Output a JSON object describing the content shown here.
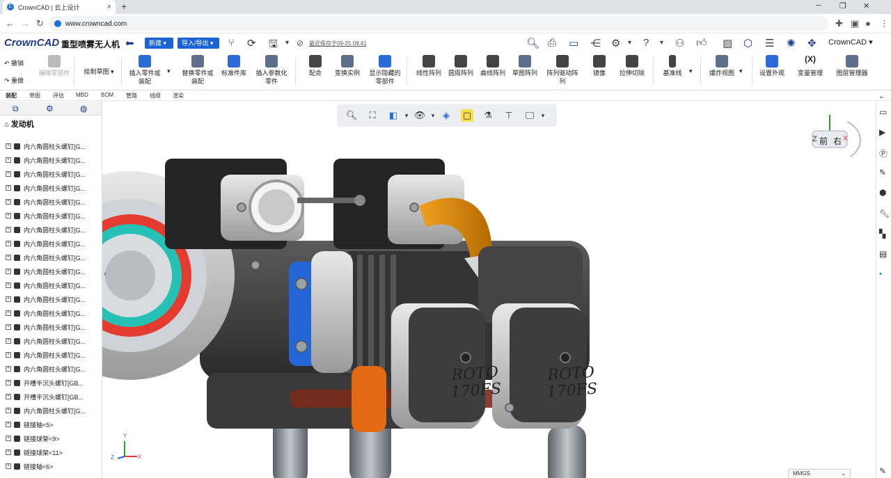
{
  "browser": {
    "tab_title": "CrownCAD | 云上设计",
    "url": "www.crowncad.com"
  },
  "app": {
    "logo_text": "CrownCAD",
    "doc_title": "重型喷雾无人机",
    "new_button": "新建",
    "import_export_button": "导入/导出",
    "saved_status": "最近保存于09-25 09:41",
    "like_count": "0",
    "brand_label": "CrownCAD"
  },
  "ribbon": {
    "undo": "撤销",
    "redo": "重做",
    "edit_part": "编辑零部件",
    "sketch_label": "绘制草图",
    "items": [
      {
        "label": "插入零件或\n装配"
      },
      {
        "label": "替换零件或\n装配"
      },
      {
        "label": "标准件库"
      },
      {
        "label": "插入参数化\n零件"
      },
      {
        "label": "配合"
      },
      {
        "label": "变换实例"
      },
      {
        "label": "显示隐藏的\n零部件"
      },
      {
        "label": "线性阵列"
      },
      {
        "label": "圆周阵列"
      },
      {
        "label": "曲线阵列"
      },
      {
        "label": "草图阵列"
      },
      {
        "label": "阵列驱动阵\n列"
      },
      {
        "label": "镜像"
      },
      {
        "label": "拉伸切除"
      },
      {
        "label": "基准线"
      },
      {
        "label": "爆炸视图"
      },
      {
        "label": "设置外观"
      },
      {
        "label": "变量管理"
      },
      {
        "label": "图层管理器"
      }
    ],
    "variable_icon_text": "(X)"
  },
  "mode_tabs": [
    "装配",
    "草图",
    "评估",
    "MBD",
    "BOM",
    "管路",
    "线缆",
    "渲染"
  ],
  "tree": {
    "root": "发动机",
    "rows": [
      "内六角圆柱头螺钉[G...",
      "内六角圆柱头螺钉[G...",
      "内六角圆柱头螺钉[G...",
      "内六角圆柱头螺钉[G...",
      "内六角圆柱头螺钉[G...",
      "内六角圆柱头螺钉[G...",
      "内六角圆柱头螺钉[G...",
      "内六角圆柱头螺钉[G...",
      "内六角圆柱头螺钉[G...",
      "内六角圆柱头螺钉[G...",
      "内六角圆柱头螺钉[G...",
      "内六角圆柱头螺钉[G...",
      "内六角圆柱头螺钉[G...",
      "内六角圆柱头螺钉[G...",
      "内六角圆柱头螺钉[G...",
      "内六角圆柱头螺钉[G...",
      "内六角圆柱头螺钉[G...",
      "开槽半沉头螺钉[GB...",
      "开槽半沉头螺钉[GB...",
      "内六角圆柱头螺钉[G...",
      "链接轴<5>",
      "链接球架<9>",
      "链接球架<11>",
      "链接轴<6>"
    ]
  },
  "viewport": {
    "viewcube_front": "前",
    "viewcube_right": "右",
    "axis_z": "Z",
    "axis_x": "X",
    "axis_y": "Y",
    "engine_label": "ROTO",
    "engine_model": "170FS",
    "units": "MMGS"
  }
}
